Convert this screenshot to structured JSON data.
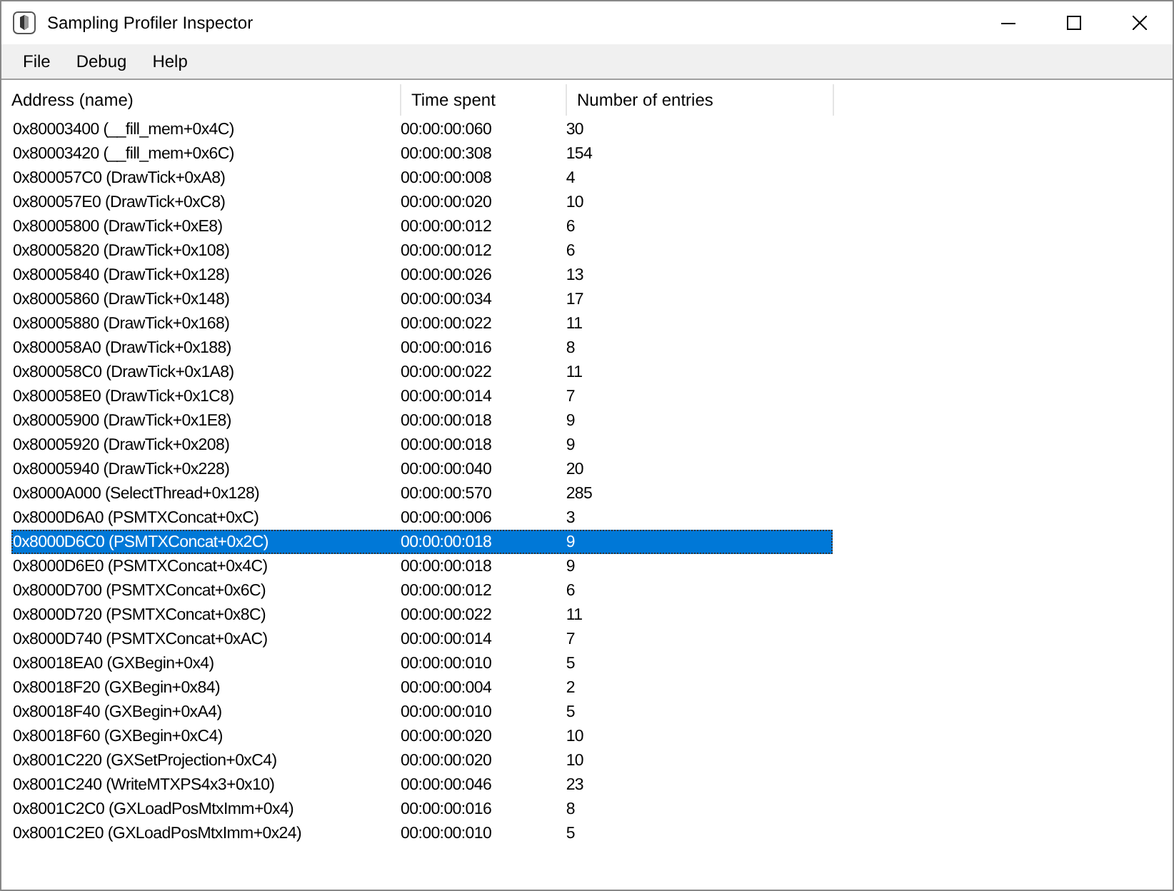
{
  "window": {
    "title": "Sampling Profiler Inspector"
  },
  "menu": [
    "File",
    "Debug",
    "Help"
  ],
  "table": {
    "columns": [
      "Address (name)",
      "Time spent",
      "Number of entries"
    ],
    "rows": [
      {
        "cells": [
          "0x80003400 (__fill_mem+0x4C)",
          "00:00:00:060",
          "30"
        ],
        "selected": false
      },
      {
        "cells": [
          "0x80003420 (__fill_mem+0x6C)",
          "00:00:00:308",
          "154"
        ],
        "selected": false
      },
      {
        "cells": [
          "0x800057C0 (DrawTick+0xA8)",
          "00:00:00:008",
          "4"
        ],
        "selected": false
      },
      {
        "cells": [
          "0x800057E0 (DrawTick+0xC8)",
          "00:00:00:020",
          "10"
        ],
        "selected": false
      },
      {
        "cells": [
          "0x80005800 (DrawTick+0xE8)",
          "00:00:00:012",
          "6"
        ],
        "selected": false
      },
      {
        "cells": [
          "0x80005820 (DrawTick+0x108)",
          "00:00:00:012",
          "6"
        ],
        "selected": false
      },
      {
        "cells": [
          "0x80005840 (DrawTick+0x128)",
          "00:00:00:026",
          "13"
        ],
        "selected": false
      },
      {
        "cells": [
          "0x80005860 (DrawTick+0x148)",
          "00:00:00:034",
          "17"
        ],
        "selected": false
      },
      {
        "cells": [
          "0x80005880 (DrawTick+0x168)",
          "00:00:00:022",
          "11"
        ],
        "selected": false
      },
      {
        "cells": [
          "0x800058A0 (DrawTick+0x188)",
          "00:00:00:016",
          "8"
        ],
        "selected": false
      },
      {
        "cells": [
          "0x800058C0 (DrawTick+0x1A8)",
          "00:00:00:022",
          "11"
        ],
        "selected": false
      },
      {
        "cells": [
          "0x800058E0 (DrawTick+0x1C8)",
          "00:00:00:014",
          "7"
        ],
        "selected": false
      },
      {
        "cells": [
          "0x80005900 (DrawTick+0x1E8)",
          "00:00:00:018",
          "9"
        ],
        "selected": false
      },
      {
        "cells": [
          "0x80005920 (DrawTick+0x208)",
          "00:00:00:018",
          "9"
        ],
        "selected": false
      },
      {
        "cells": [
          "0x80005940 (DrawTick+0x228)",
          "00:00:00:040",
          "20"
        ],
        "selected": false
      },
      {
        "cells": [
          "0x8000A000 (SelectThread+0x128)",
          "00:00:00:570",
          "285"
        ],
        "selected": false
      },
      {
        "cells": [
          "0x8000D6A0 (PSMTXConcat+0xC)",
          "00:00:00:006",
          "3"
        ],
        "selected": false
      },
      {
        "cells": [
          "0x8000D6C0 (PSMTXConcat+0x2C)",
          "00:00:00:018",
          "9"
        ],
        "selected": true
      },
      {
        "cells": [
          "0x8000D6E0 (PSMTXConcat+0x4C)",
          "00:00:00:018",
          "9"
        ],
        "selected": false
      },
      {
        "cells": [
          "0x8000D700 (PSMTXConcat+0x6C)",
          "00:00:00:012",
          "6"
        ],
        "selected": false
      },
      {
        "cells": [
          "0x8000D720 (PSMTXConcat+0x8C)",
          "00:00:00:022",
          "11"
        ],
        "selected": false
      },
      {
        "cells": [
          "0x8000D740 (PSMTXConcat+0xAC)",
          "00:00:00:014",
          "7"
        ],
        "selected": false
      },
      {
        "cells": [
          "0x80018EA0 (GXBegin+0x4)",
          "00:00:00:010",
          "5"
        ],
        "selected": false
      },
      {
        "cells": [
          "0x80018F20 (GXBegin+0x84)",
          "00:00:00:004",
          "2"
        ],
        "selected": false
      },
      {
        "cells": [
          "0x80018F40 (GXBegin+0xA4)",
          "00:00:00:010",
          "5"
        ],
        "selected": false
      },
      {
        "cells": [
          "0x80018F60 (GXBegin+0xC4)",
          "00:00:00:020",
          "10"
        ],
        "selected": false
      },
      {
        "cells": [
          "0x8001C220 (GXSetProjection+0xC4)",
          "00:00:00:020",
          "10"
        ],
        "selected": false
      },
      {
        "cells": [
          "0x8001C240 (WriteMTXPS4x3+0x10)",
          "00:00:00:046",
          "23"
        ],
        "selected": false
      },
      {
        "cells": [
          "0x8001C2C0 (GXLoadPosMtxImm+0x4)",
          "00:00:00:016",
          "8"
        ],
        "selected": false
      },
      {
        "cells": [
          "0x8001C2E0 (GXLoadPosMtxImm+0x24)",
          "00:00:00:010",
          "5"
        ],
        "selected": false
      }
    ]
  }
}
